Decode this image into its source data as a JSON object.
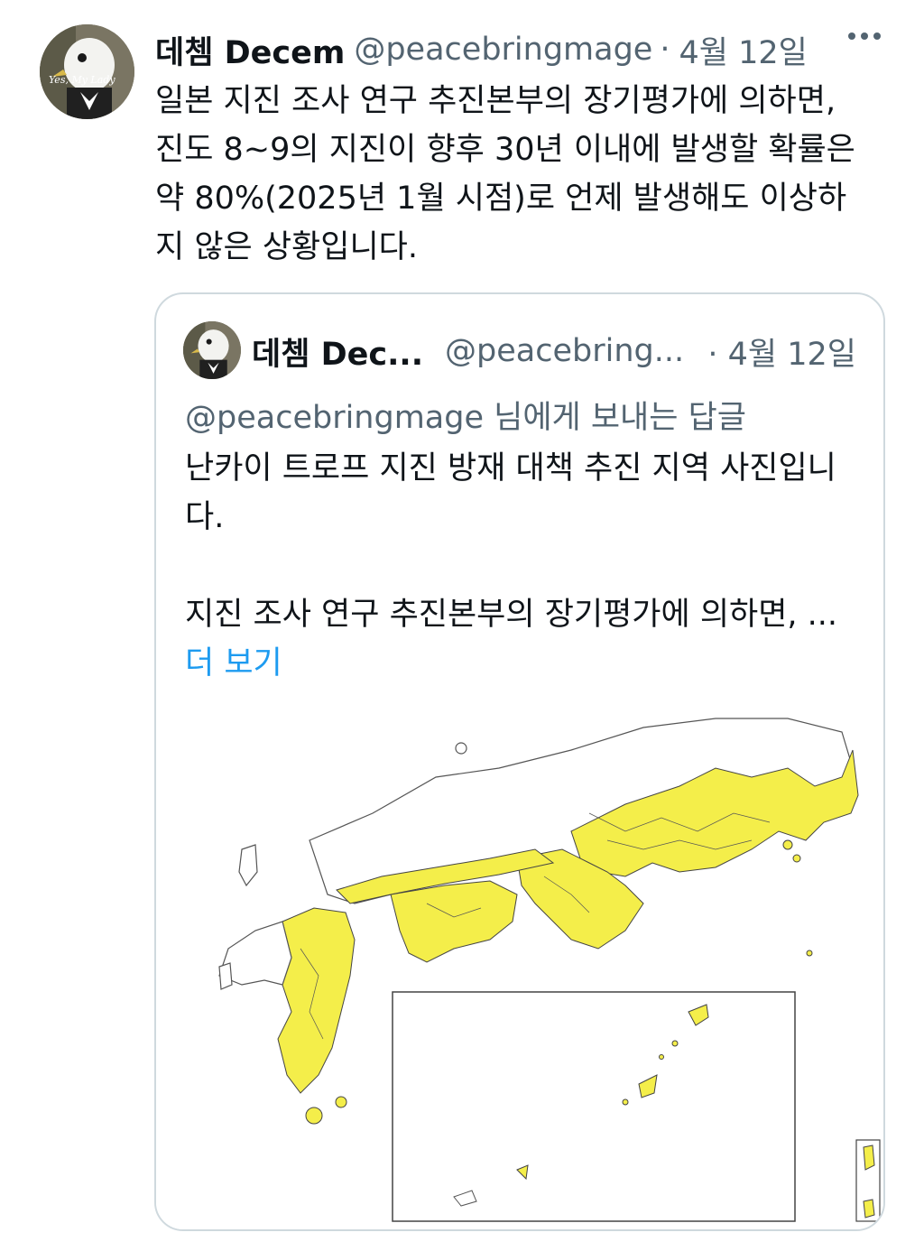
{
  "tweet": {
    "display_name": "데쳄 Decem",
    "handle": "@peacebringmage",
    "separator": "·",
    "date": "4월 12일",
    "avatar_caption": "Yes, My Lady",
    "text_lines": [
      "일본 지진 조사 연구 추진본부의 장기평가에 의하면,",
      "진도 8~9의 지진이 향후 30년 이내에 발생할 확률은",
      "약 80%(2025년 1월 시점)로 언제 발생해도 이상하",
      "지 않은 상황입니다."
    ]
  },
  "quote": {
    "display_name": "데쳄 Dec...",
    "handle": "@peacebring...",
    "date": "· 4월 12일",
    "reply_mention": "@peacebringmage",
    "reply_suffix": " 님에게 보내는 답글",
    "text_lines_1": [
      "난카이 트로프 지진 방재 대책 추진 지역 사진입니",
      "다."
    ],
    "text_line_2": "지진 조사 연구 추진본부의 장기평가에 의하면, ...",
    "show_more": "더 보기",
    "map": {
      "highlight_color": "#f4ee4a",
      "land_color": "#ffffff",
      "border_color": "#555555"
    }
  },
  "colors": {
    "text": "#0f1419",
    "secondary": "#536471",
    "link": "#1d9bf0",
    "card_border": "#cfd9de"
  }
}
